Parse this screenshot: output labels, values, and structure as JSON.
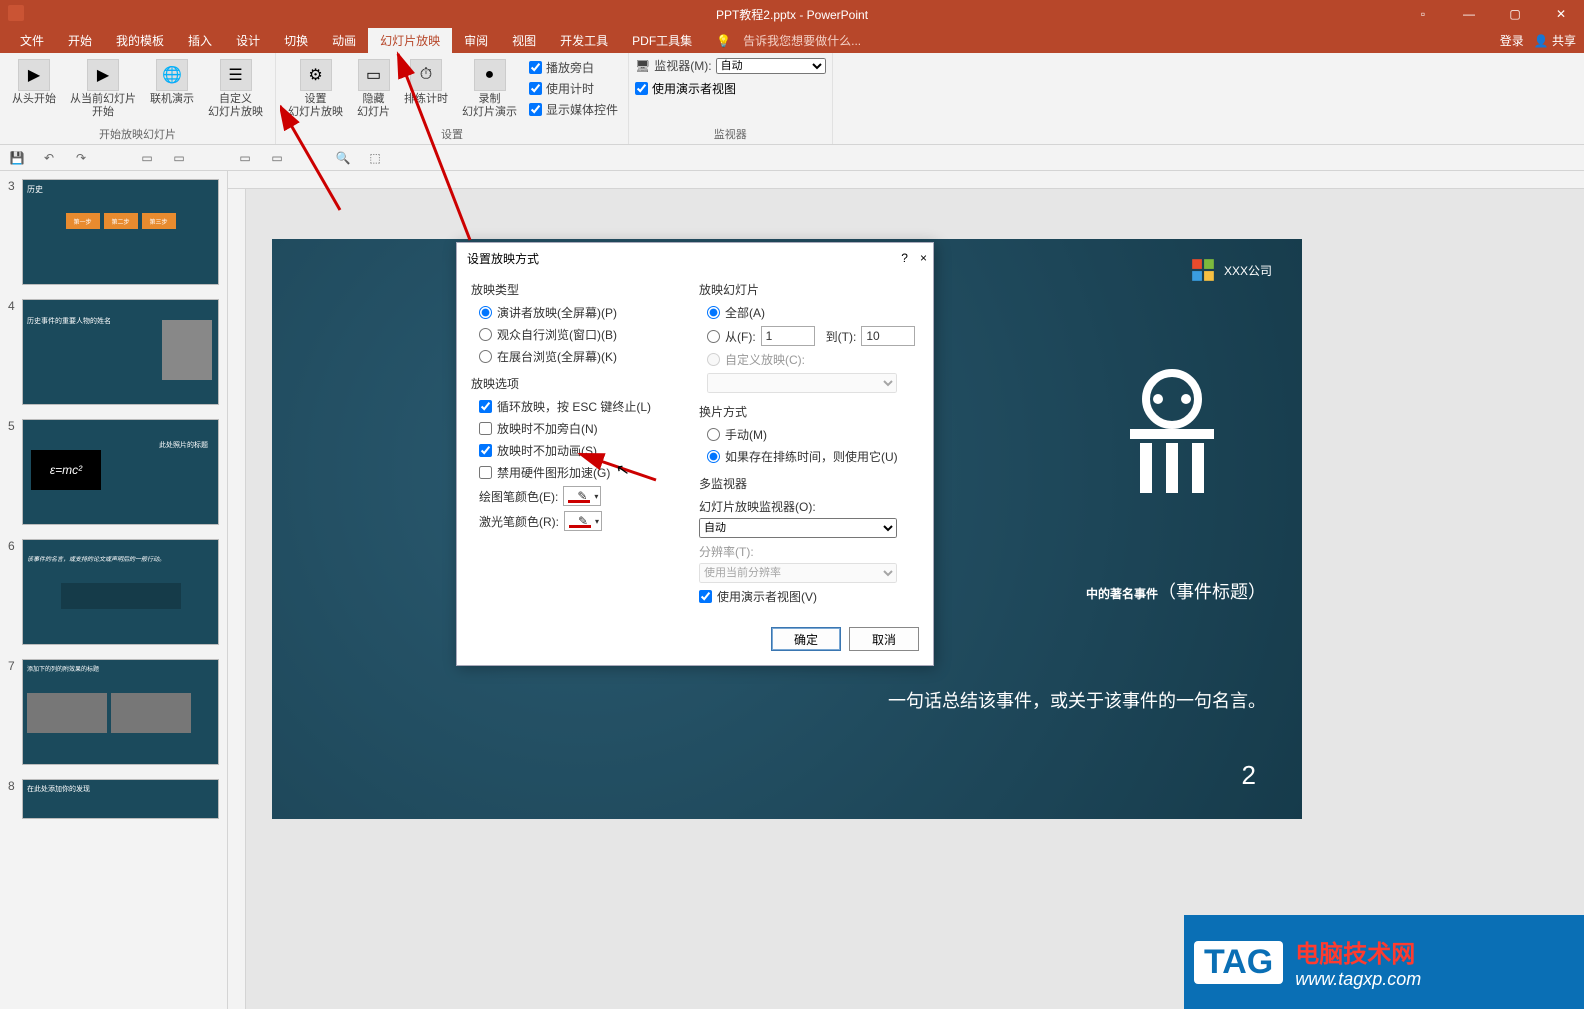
{
  "title": "PPT教程2.pptx - PowerPoint",
  "menutabs": {
    "file": "文件",
    "start": "开始",
    "mytpl": "我的模板",
    "insert": "插入",
    "design": "设计",
    "trans": "切换",
    "anim": "动画",
    "slideshow": "幻灯片放映",
    "review": "审阅",
    "view": "视图",
    "dev": "开发工具",
    "pdf": "PDF工具集",
    "tellme": "告诉我您想要做什么...",
    "login": "登录",
    "share": "共享"
  },
  "ribbon": {
    "fromstart": "从头开始",
    "fromcurrent": "从当前幻灯片\n开始",
    "online": "联机演示",
    "custom": "自定义\n幻灯片放映",
    "group1": "开始放映幻灯片",
    "setup": "设置\n幻灯片放映",
    "hide": "隐藏\n幻灯片",
    "rehearse": "排练计时",
    "record": "录制\n幻灯片演示",
    "group2": "设置",
    "narr": "播放旁白",
    "timing": "使用计时",
    "media": "显示媒体控件",
    "monlabel": "监视器(M):",
    "monval": "自动",
    "presenter": "使用演示者视图",
    "group3": "监视器"
  },
  "thumbs": {
    "n3": "3",
    "n4": "4",
    "n5": "5",
    "n6": "6",
    "n7": "7",
    "n8": "8"
  },
  "slide": {
    "company": "XXX公司",
    "bigtitle": "中的著名事件",
    "subtitle": "（事件标题）",
    "tagline": "一句话总结该事件，或关于该事件的一句名言。",
    "pagenum": "2"
  },
  "dialog": {
    "title": "设置放映方式",
    "help": "?",
    "close": "×",
    "sec_type": "放映类型",
    "type1": "演讲者放映(全屏幕)(P)",
    "type2": "观众自行浏览(窗口)(B)",
    "type3": "在展台浏览(全屏幕)(K)",
    "sec_opt": "放映选项",
    "opt1": "循环放映，按 ESC 键终止(L)",
    "opt2": "放映时不加旁白(N)",
    "opt3": "放映时不加动画(S)",
    "opt4": "禁用硬件图形加速(G)",
    "pencolor": "绘图笔颜色(E):",
    "laser": "激光笔颜色(R):",
    "sec_slides": "放映幻灯片",
    "all": "全部(A)",
    "from": "从(F):",
    "fromv": "1",
    "to": "到(T):",
    "tov": "10",
    "customshow": "自定义放映(C):",
    "sec_advance": "换片方式",
    "manual": "手动(M)",
    "iftiming": "如果存在排练时间，则使用它(U)",
    "sec_multi": "多监视器",
    "monitor": "幻灯片放映监视器(O):",
    "monv": "自动",
    "res": "分辨率(T):",
    "resv": "使用当前分辨率",
    "usepresenter": "使用演示者视图(V)",
    "ok": "确定",
    "cancel": "取消"
  },
  "watermark": {
    "tag": "TAG",
    "l1": "电脑技术网",
    "l2": "www.tagxp.com"
  }
}
